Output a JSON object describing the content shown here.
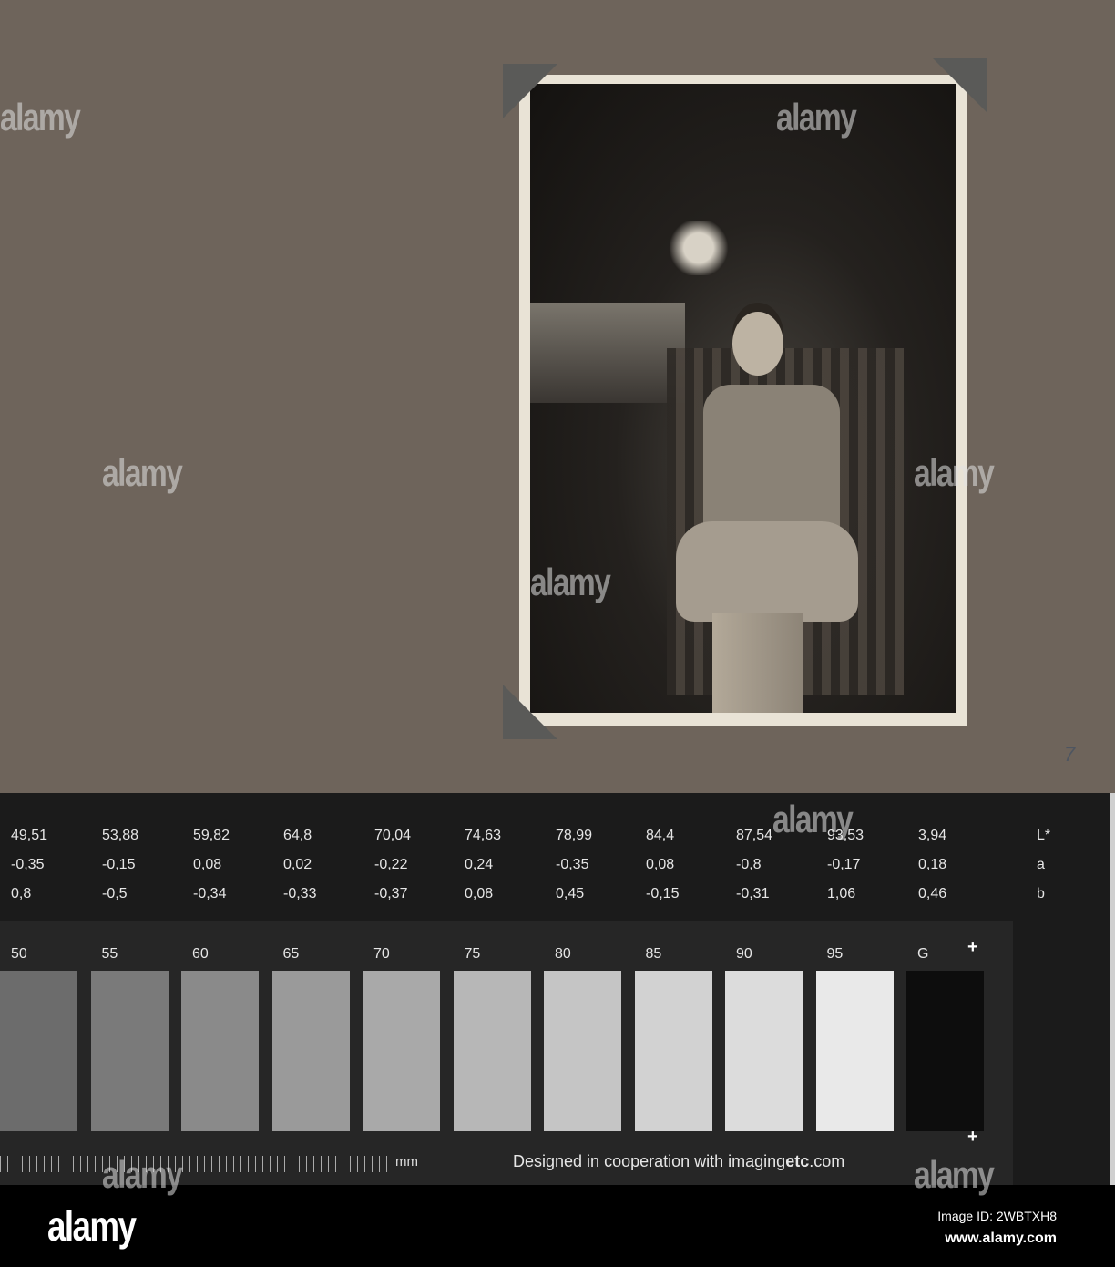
{
  "pencil_mark": "7",
  "chart": {
    "L_values": [
      "49,51",
      "53,88",
      "59,82",
      "64,8",
      "70,04",
      "74,63",
      "78,99",
      "84,4",
      "87,54",
      "93,53",
      "3,94"
    ],
    "a_values": [
      "-0,35",
      "-0,15",
      "0,08",
      "0,02",
      "-0,22",
      "0,24",
      "-0,35",
      "0,08",
      "-0,8",
      "-0,17",
      "0,18"
    ],
    "b_values": [
      "0,8",
      "-0,5",
      "-0,34",
      "-0,33",
      "-0,37",
      "0,08",
      "0,45",
      "-0,15",
      "-0,31",
      "1,06",
      "0,46"
    ],
    "row_labels": [
      "L*",
      "a",
      "b"
    ],
    "patch_labels": [
      "50",
      "55",
      "60",
      "65",
      "70",
      "75",
      "80",
      "85",
      "90",
      "95",
      "G"
    ],
    "patch_colors": [
      "#6c6c6c",
      "#7a7a7a",
      "#8a8a8a",
      "#9a9a9a",
      "#a9a9a9",
      "#b7b7b7",
      "#c5c5c5",
      "#d2d2d2",
      "#dcdcdc",
      "#e9e9e9",
      "#0d0d0d"
    ],
    "ruler_unit": "mm",
    "credit_prefix": "Designed in cooperation with imaging",
    "credit_bold": "etc",
    "credit_suffix": ".com"
  },
  "footer": {
    "logo": "alamy",
    "image_id": "Image ID: 2WBTXH8",
    "site": "www.alamy.com"
  },
  "watermark": "alamy"
}
